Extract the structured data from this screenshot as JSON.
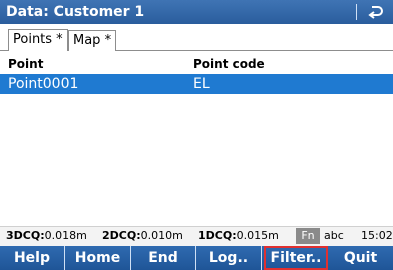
{
  "window": {
    "title": "Data: Customer 1",
    "back_icon": "return-arrow-icon"
  },
  "tabs": [
    {
      "label": "Points *",
      "active": true
    },
    {
      "label": "Map *",
      "active": false
    }
  ],
  "table": {
    "columns": [
      "Point",
      "Point code"
    ],
    "rows": [
      {
        "point": "Point0001",
        "code": "EL",
        "selected": true
      }
    ]
  },
  "status": {
    "3dcq_label": "3DCQ:",
    "3dcq_value": "0.018m",
    "2dcq_label": "2DCQ:",
    "2dcq_value": "0.010m",
    "1dcq_label": "1DCQ:",
    "1dcq_value": "0.015m",
    "fn": "Fn",
    "input_mode": "abc",
    "time": "15:02"
  },
  "softkeys": [
    "Help",
    "Home",
    "End",
    "Log..",
    "Filter..",
    "Quit"
  ],
  "colors": {
    "title_bg": "#2f66a8",
    "selection": "#1f7ad1",
    "softkey_bg": "#225b9f",
    "highlight_border": "#e03030"
  }
}
